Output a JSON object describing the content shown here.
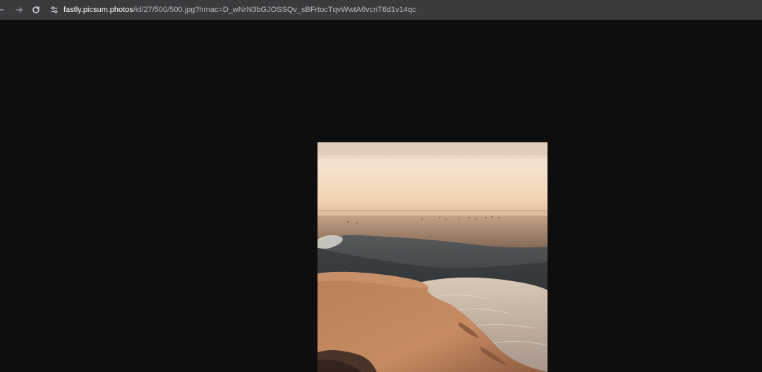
{
  "browser": {
    "url_domain": "fastly.picsum.photos",
    "url_path": "/id/27/500/500.jpg?hmac=D_wNrN3bGJOSSQv_sBFrtocTqvWwtA6vcnT6d1v14qc",
    "icons": {
      "back": "arrow-left-icon",
      "forward": "arrow-right-icon",
      "reload": "reload-icon",
      "site_info": "tune-icon"
    }
  },
  "colors": {
    "toolbar_bg": "#3b3b3d",
    "page_bg": "#0e0e0f"
  },
  "image": {
    "subject": "sunset-beach-waves-photo"
  }
}
